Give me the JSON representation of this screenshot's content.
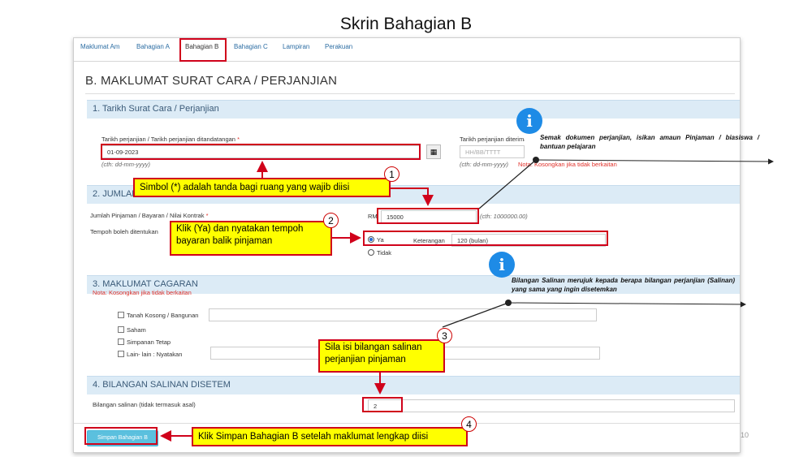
{
  "slide": {
    "title": "Skrin Bahagian B",
    "page_number": "10"
  },
  "tabs": [
    "Maklumat Am",
    "Bahagian A",
    "Bahagian B",
    "Bahagian C",
    "Lampiran",
    "Perakuan"
  ],
  "page_title": "B. MAKLUMAT SURAT CARA / PERJANJIAN",
  "section1": {
    "title": "1. Tarikh Surat Cara / Perjanjian",
    "date_label": "Tarikh perjanjian / Tarikh perjanjian ditandatangan",
    "required_mark": "*",
    "date_value": "01-09-2023",
    "date_hint": "(cth: dd-mm-yyyy)",
    "received_label": "Tarikh perjanjian diterima",
    "received_placeholder": "HH/BB/TTTT",
    "received_hint": "(cth: dd-mm-yyyy)",
    "received_note": "Nota: Kosongkan jika tidak berkaitan"
  },
  "section2": {
    "title": "2. JUMLAH",
    "amount_label": "Jumlah Pinjaman / Bayaran / Nilai Kontrak",
    "currency": "RM",
    "amount_value": "15000",
    "amount_hint": "(cth: 1000000.00)",
    "tempoh_label": "Tempoh boleh ditentukan",
    "radio_yes": "Ya",
    "radio_no": "Tidak",
    "keterangan_label": "Keterangan",
    "keterangan_value": "120 (bulan)"
  },
  "section3": {
    "title": "3. MAKLUMAT CAGARAN",
    "note": "Nota: Kosongkan jika tidak berkaitan",
    "options": [
      "Tanah Kosong / Bangunan",
      "Saham",
      "Simpanan Tetap",
      "Lain- lain : Nyatakan"
    ]
  },
  "section4": {
    "title": "4. BILANGAN SALINAN DISETEM",
    "copies_label": "Bilangan salinan (tidak termasuk asal)",
    "copies_value": "2"
  },
  "save_button": "Simpan Bahagian B",
  "callouts": {
    "c1": "Simbol (*) adalah tanda bagi ruang yang wajib diisi",
    "c2": "Klik (Ya) dan nyatakan tempoh bayaran balik pinjaman",
    "c3": "Sila isi bilangan salinan perjanjian pinjaman",
    "c4": "Klik Simpan Bahagian B setelah maklumat lengkap diisi"
  },
  "steps": [
    "1",
    "2",
    "3",
    "4"
  ],
  "info": {
    "icon": "i",
    "amount_note": "Semak dokumen perjanjian, isikan amaun Pinjaman / biasiswa / bantuan pelajaran",
    "copies_note": "Bilangan Salinan merujuk kepada berapa bilangan perjanjian (Salinan) yang sama yang ingin disetemkan"
  },
  "colors": {
    "highlight_red": "#d0021b",
    "callout_yellow": "#ffff00",
    "info_blue": "#1e8be6",
    "button_blue": "#5bc0de",
    "section_bg": "#dcebf6"
  }
}
